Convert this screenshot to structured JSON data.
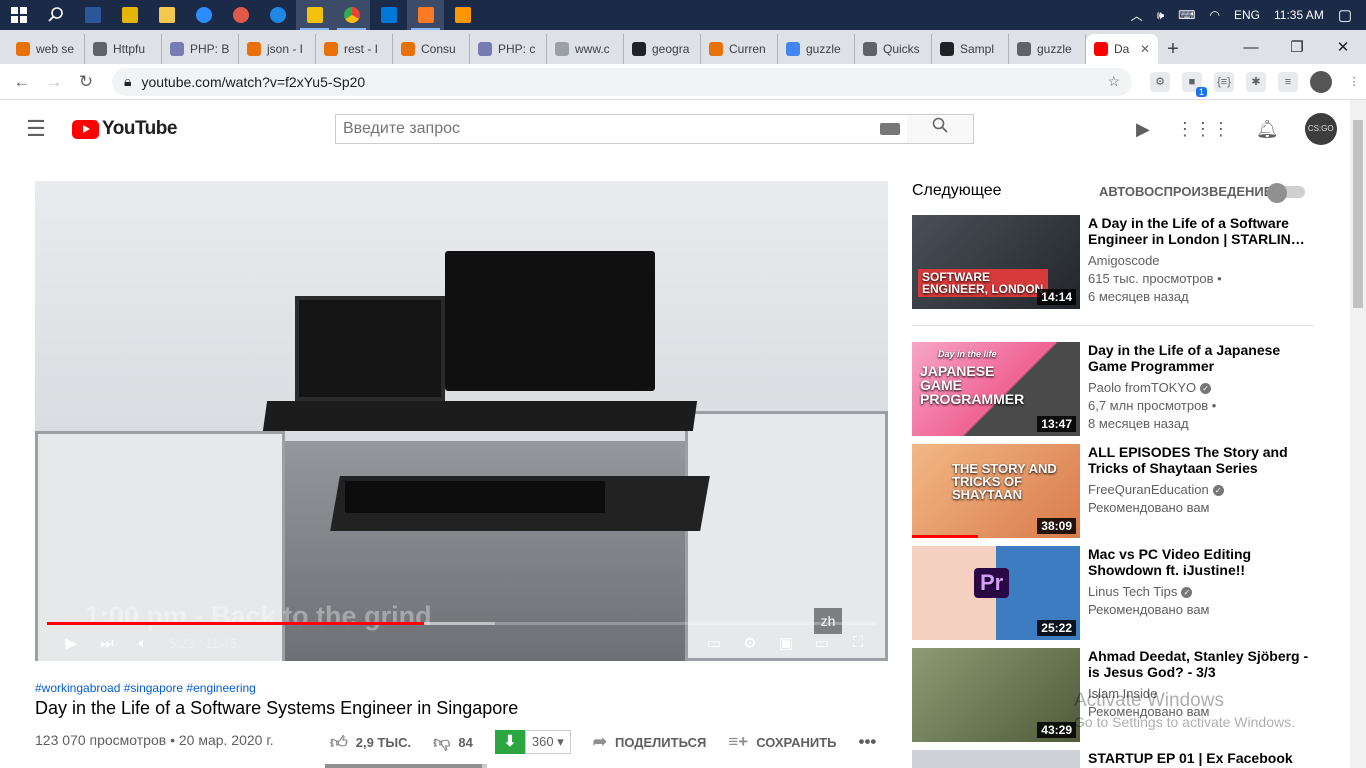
{
  "taskbar": {
    "apps": [
      {
        "name": "windows-start-icon",
        "color": "#ffffff"
      },
      {
        "name": "search-icon",
        "color": "#ffffff"
      },
      {
        "name": "word-icon",
        "color": "#2b579a"
      },
      {
        "name": "app-yellow-icon",
        "color": "#e3b505"
      },
      {
        "name": "file-explorer-icon",
        "color": "#f2c94c"
      },
      {
        "name": "zoom-icon",
        "color": "#2d8cff"
      },
      {
        "name": "app-paint-icon",
        "color": "#e05a47"
      },
      {
        "name": "edge-icon",
        "color": "#1e88e5"
      },
      {
        "name": "sticky-notes-icon",
        "color": "#f4c20d"
      },
      {
        "name": "chrome-icon",
        "color": "#4caf50"
      },
      {
        "name": "vscode-icon",
        "color": "#0078d7"
      },
      {
        "name": "xampp-icon",
        "color": "#fb7a24"
      },
      {
        "name": "sublime-icon",
        "color": "#ff9800"
      }
    ],
    "language": "ENG",
    "time": "11:35 AM"
  },
  "tabs": [
    {
      "label": "web se",
      "color": "#e8710a"
    },
    {
      "label": "Httpfu",
      "color": "#5f6368"
    },
    {
      "label": "PHP: B",
      "color": "#777bb3"
    },
    {
      "label": "json - I",
      "color": "#e8710a"
    },
    {
      "label": "rest - I",
      "color": "#e8710a"
    },
    {
      "label": "Consu",
      "color": "#e8710a"
    },
    {
      "label": "PHP: c",
      "color": "#777bb3"
    },
    {
      "label": "www.c",
      "color": "#9aa0a6"
    },
    {
      "label": "geogra",
      "color": "#202124"
    },
    {
      "label": "Curren",
      "color": "#e8710a"
    },
    {
      "label": "guzzle",
      "color": "#4285f4"
    },
    {
      "label": "Quicks",
      "color": "#5f6368"
    },
    {
      "label": "Sampl",
      "color": "#202124"
    },
    {
      "label": "guzzle",
      "color": "#5f6368"
    },
    {
      "label": "Da",
      "color": "#ff0000"
    }
  ],
  "browser": {
    "url": "youtube.com/watch?v=f2xYu5-Sp20",
    "ext_badge": "1"
  },
  "youtube": {
    "logo_text": "YouTube",
    "search_placeholder": "Введите запрос",
    "avatar_text": "CS:GO"
  },
  "player": {
    "subtitle_overlay": "1:00 pm - Back to the grind",
    "caption_lang": "zh",
    "time": "5:23 / 11:45",
    "progress_played": 0.455,
    "progress_buffered": 0.54
  },
  "video": {
    "tags": "#workingabroad #singapore #engineering",
    "title": "Day in the Life of a Software Systems Engineer in Singapore",
    "views": "123 070 просмотров • 20 мар. 2020 г.",
    "likes": "2,9 ТЫС.",
    "dislikes": "84",
    "downloads": "360",
    "share_label": "ПОДЕЛИТЬСЯ",
    "save_label": "СОХРАНИТЬ",
    "like_ratio": 0.97
  },
  "sidebar": {
    "up_next": "Следующее",
    "autoplay": "АВТОВОСПРОИЗВЕДЕНИЕ",
    "items": [
      {
        "title": "A Day in the Life of a Software Engineer in London | STARLIN…",
        "channel": "Amigoscode",
        "line1": "615 тыс. просмотров •",
        "line2": "6 месяцев назад",
        "duration": "14:14",
        "thumb_text": "SOFTWARE ENGINEER, LONDON",
        "verified": false
      },
      {
        "title": "Day in the Life of a Japanese Game Programmer",
        "channel": "Paolo fromTOKYO",
        "line1": "6,7 млн просмотров •",
        "line2": "8 месяцев назад",
        "duration": "13:47",
        "thumb_text": "JAPANESE GAME PROGRAMMER",
        "thumb_small": "Day in the life",
        "verified": true
      },
      {
        "title": "ALL EPISODES The Story and Tricks of Shaytaan Series",
        "channel": "FreeQuranEducation",
        "line1": "Рекомендовано вам",
        "line2": "",
        "duration": "38:09",
        "thumb_text": "THE STORY AND TRICKS OF SHAYTAAN",
        "verified": true
      },
      {
        "title": "Mac vs PC Video Editing Showdown ft. iJustine!!",
        "channel": "Linus Tech Tips",
        "line1": "Рекомендовано вам",
        "line2": "",
        "duration": "25:22",
        "thumb_text": "Pr",
        "verified": true
      },
      {
        "title": "Ahmad Deedat, Stanley Sjöberg - is Jesus God? - 3/3",
        "channel": "Islam Inside",
        "line1": "Рекомендовано вам",
        "line2": "",
        "duration": "43:29",
        "verified": false
      },
      {
        "title": "STARTUP EP 01 | Ex Facebook",
        "channel": "",
        "line1": "",
        "line2": "",
        "duration": "",
        "verified": false
      }
    ]
  },
  "watermark": {
    "title": "Activate Windows",
    "subtitle": "Go to Settings to activate Windows."
  }
}
